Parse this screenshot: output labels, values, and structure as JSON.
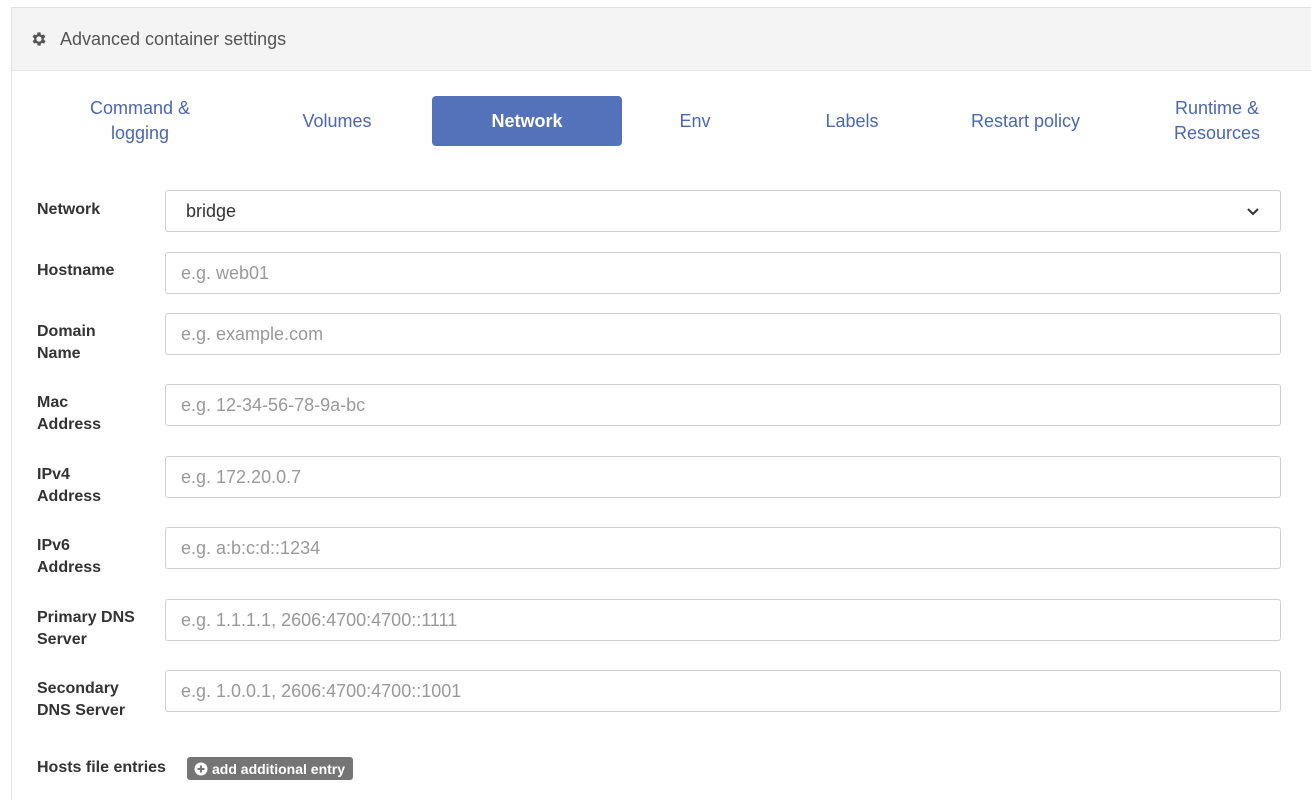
{
  "header": {
    "title": "Advanced container settings",
    "icon": "gear-icon"
  },
  "tabs": [
    {
      "label": "Command & logging",
      "active": false
    },
    {
      "label": "Volumes",
      "active": false
    },
    {
      "label": "Network",
      "active": true
    },
    {
      "label": "Env",
      "active": false
    },
    {
      "label": "Labels",
      "active": false
    },
    {
      "label": "Restart policy",
      "active": false
    },
    {
      "label": "Runtime & Resources",
      "active": false
    }
  ],
  "form": {
    "network": {
      "label": "Network",
      "value": "bridge"
    },
    "hostname": {
      "label": "Hostname",
      "placeholder": "e.g. web01"
    },
    "domain": {
      "label": "Domain Name",
      "placeholder": "e.g. example.com"
    },
    "mac": {
      "label": "Mac Address",
      "placeholder": "e.g. 12-34-56-78-9a-bc"
    },
    "ipv4": {
      "label": "IPv4 Address",
      "placeholder": "e.g. 172.20.0.7"
    },
    "ipv6": {
      "label": "IPv6 Address",
      "placeholder": "e.g. a:b:c:d::1234"
    },
    "primary_dns": {
      "label": "Primary DNS Server",
      "placeholder": "e.g. 1.1.1.1, 2606:4700:4700::1111"
    },
    "secondary_dns": {
      "label": "Secondary DNS Server",
      "placeholder": "e.g. 1.0.0.1, 2606:4700:4700::1001"
    }
  },
  "hosts": {
    "label": "Hosts file entries",
    "add_label": "add additional entry"
  },
  "colors": {
    "accent": "#5472ba",
    "tab_text": "#4a67b0",
    "header_bg": "#f4f4f4",
    "button_gray": "#757575"
  }
}
